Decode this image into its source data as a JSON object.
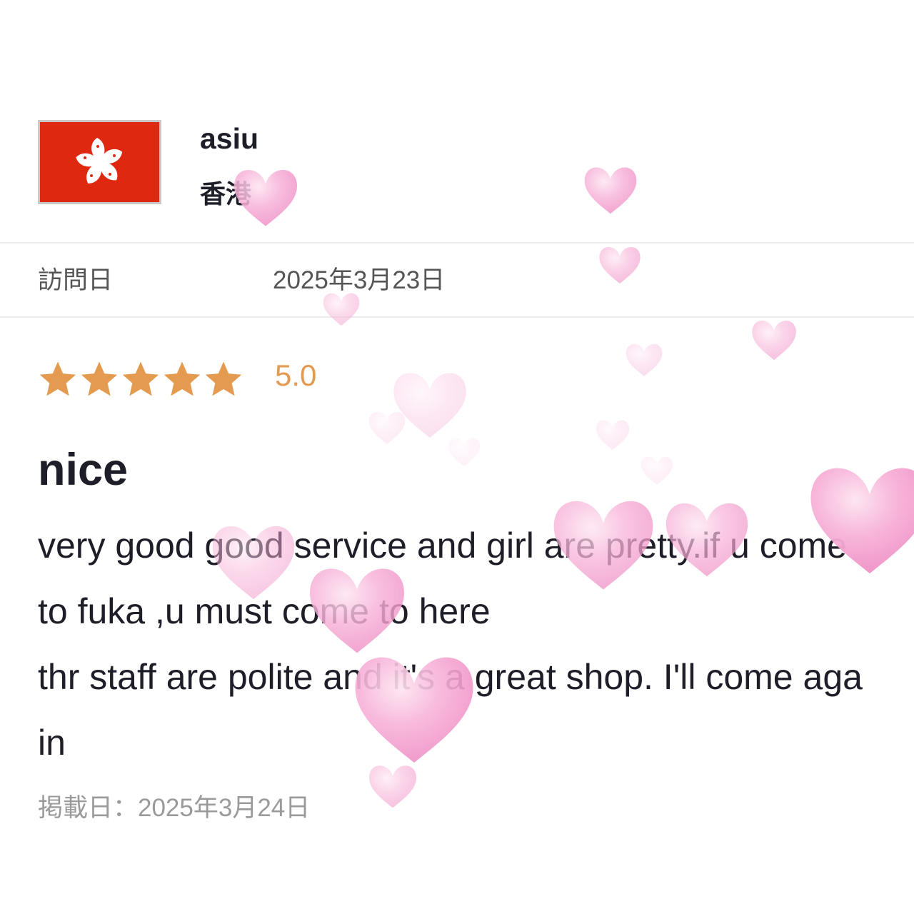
{
  "reviewer": {
    "name": "asiu",
    "region": "香港",
    "flag_icon": "hong-kong-flag-icon"
  },
  "visit": {
    "label": "訪問日",
    "date": "2025年3月23日"
  },
  "rating": {
    "stars": 5,
    "max_stars": 5,
    "score": "5.0",
    "star_color": "#e49a4f"
  },
  "review": {
    "title": "nice",
    "body": "very good good service and girl are pretty.if u come to fuka ,u must come to here\nthr staff are polite and it's a great shop. I'll come again"
  },
  "posted": {
    "text": "掲載日：2025年3月24日"
  },
  "colors": {
    "heart_pink": "#f6a9d2",
    "flag_red": "#de2910",
    "text_dark": "#1e1e28",
    "text_gray": "#9a9a9a"
  }
}
